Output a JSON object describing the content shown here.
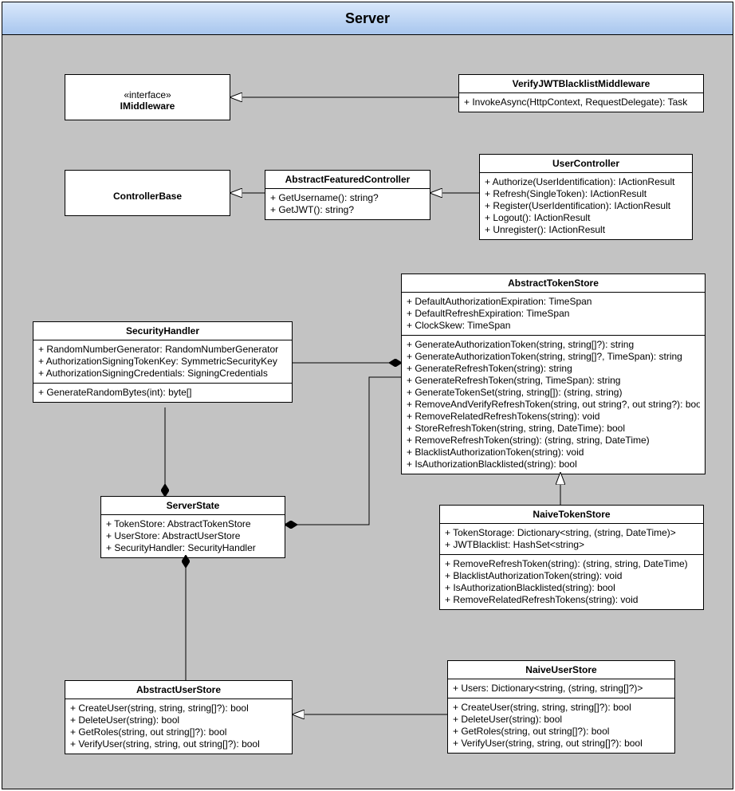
{
  "chart_data": {
    "type": "uml-class",
    "package": "Server",
    "classes": [
      {
        "id": "IMiddleware",
        "stereotype": "«interface»",
        "name": "IMiddleware"
      },
      {
        "id": "VerifyJWTBlacklistMiddleware",
        "name": "VerifyJWTBlacklistMiddleware",
        "methods": [
          "+ InvokeAsync(HttpContext, RequestDelegate): Task"
        ]
      },
      {
        "id": "ControllerBase",
        "name": "ControllerBase"
      },
      {
        "id": "AbstractFeaturedController",
        "name": "AbstractFeaturedController",
        "methods": [
          "+ GetUsername(): string?",
          "+ GetJWT(): string?"
        ]
      },
      {
        "id": "UserController",
        "name": "UserController",
        "methods": [
          "+ Authorize(UserIdentification): IActionResult",
          "+ Refresh(SingleToken): IActionResult",
          "+ Register(UserIdentification): IActionResult",
          "+ Logout(): IActionResult",
          "+ Unregister(): IActionResult"
        ]
      },
      {
        "id": "SecurityHandler",
        "name": "SecurityHandler",
        "fields": [
          "+ RandomNumberGenerator: RandomNumberGenerator",
          "+ AuthorizationSigningTokenKey: SymmetricSecurityKey",
          "+ AuthorizationSigningCredentials: SigningCredentials"
        ],
        "methods": [
          "+ GenerateRandomBytes(int): byte[]"
        ]
      },
      {
        "id": "AbstractTokenStore",
        "name": "AbstractTokenStore",
        "fields": [
          "+ DefaultAuthorizationExpiration: TimeSpan",
          "+ DefaultRefreshExpiration: TimeSpan",
          "+ ClockSkew: TimeSpan"
        ],
        "methods": [
          "+ GenerateAuthorizationToken(string, string[]?): string",
          "+ GenerateAuthorizationToken(string, string[]?, TimeSpan): string",
          "+ GenerateRefreshToken(string): string",
          "+ GenerateRefreshToken(string, TimeSpan): string",
          "+ GenerateTokenSet(string, string[]): (string, string)",
          "+ RemoveAndVerifyRefreshToken(string, out string?, out string?): bool",
          "+ RemoveRelatedRefreshTokens(string): void",
          "+ StoreRefreshToken(string, string, DateTime): bool",
          "+ RemoveRefreshToken(string): (string, string, DateTime)",
          "+ BlacklistAuthorizationToken(string): void",
          "+ IsAuthorizationBlacklisted(string): bool"
        ]
      },
      {
        "id": "ServerState",
        "name": "ServerState",
        "fields": [
          "+ TokenStore: AbstractTokenStore",
          "+ UserStore: AbstractUserStore",
          "+ SecurityHandler: SecurityHandler"
        ]
      },
      {
        "id": "NaiveTokenStore",
        "name": "NaiveTokenStore",
        "fields": [
          "+ TokenStorage: Dictionary<string, (string, DateTime)>",
          "+ JWTBlacklist: HashSet<string>"
        ],
        "methods": [
          "+ RemoveRefreshToken(string): (string, string, DateTime)",
          "+ BlacklistAuthorizationToken(string): void",
          "+ IsAuthorizationBlacklisted(string): bool",
          "+ RemoveRelatedRefreshTokens(string): void"
        ]
      },
      {
        "id": "AbstractUserStore",
        "name": "AbstractUserStore",
        "methods": [
          "+ CreateUser(string, string, string[]?): bool",
          "+ DeleteUser(string): bool",
          "+ GetRoles(string, out string[]?): bool",
          "+ VerifyUser(string, string, out string[]?): bool"
        ]
      },
      {
        "id": "NaiveUserStore",
        "name": "NaiveUserStore",
        "fields": [
          "+ Users: Dictionary<string, (string, string[]?)>"
        ],
        "methods": [
          "+ CreateUser(string, string, string[]?): bool",
          "+ DeleteUser(string): bool",
          "+ GetRoles(string, out string[]?): bool",
          "+ VerifyUser(string, string, out string[]?): bool"
        ]
      }
    ],
    "relations": [
      {
        "from": "VerifyJWTBlacklistMiddleware",
        "to": "IMiddleware",
        "type": "realization"
      },
      {
        "from": "AbstractFeaturedController",
        "to": "ControllerBase",
        "type": "generalization"
      },
      {
        "from": "UserController",
        "to": "AbstractFeaturedController",
        "type": "generalization"
      },
      {
        "from": "NaiveTokenStore",
        "to": "AbstractTokenStore",
        "type": "generalization"
      },
      {
        "from": "NaiveUserStore",
        "to": "AbstractUserStore",
        "type": "generalization"
      },
      {
        "from": "ServerState",
        "to": "SecurityHandler",
        "type": "composition"
      },
      {
        "from": "ServerState",
        "to": "AbstractTokenStore",
        "type": "composition"
      },
      {
        "from": "ServerState",
        "to": "AbstractUserStore",
        "type": "composition"
      },
      {
        "from": "AbstractTokenStore",
        "to": "SecurityHandler",
        "type": "composition"
      }
    ]
  },
  "title": "Server"
}
